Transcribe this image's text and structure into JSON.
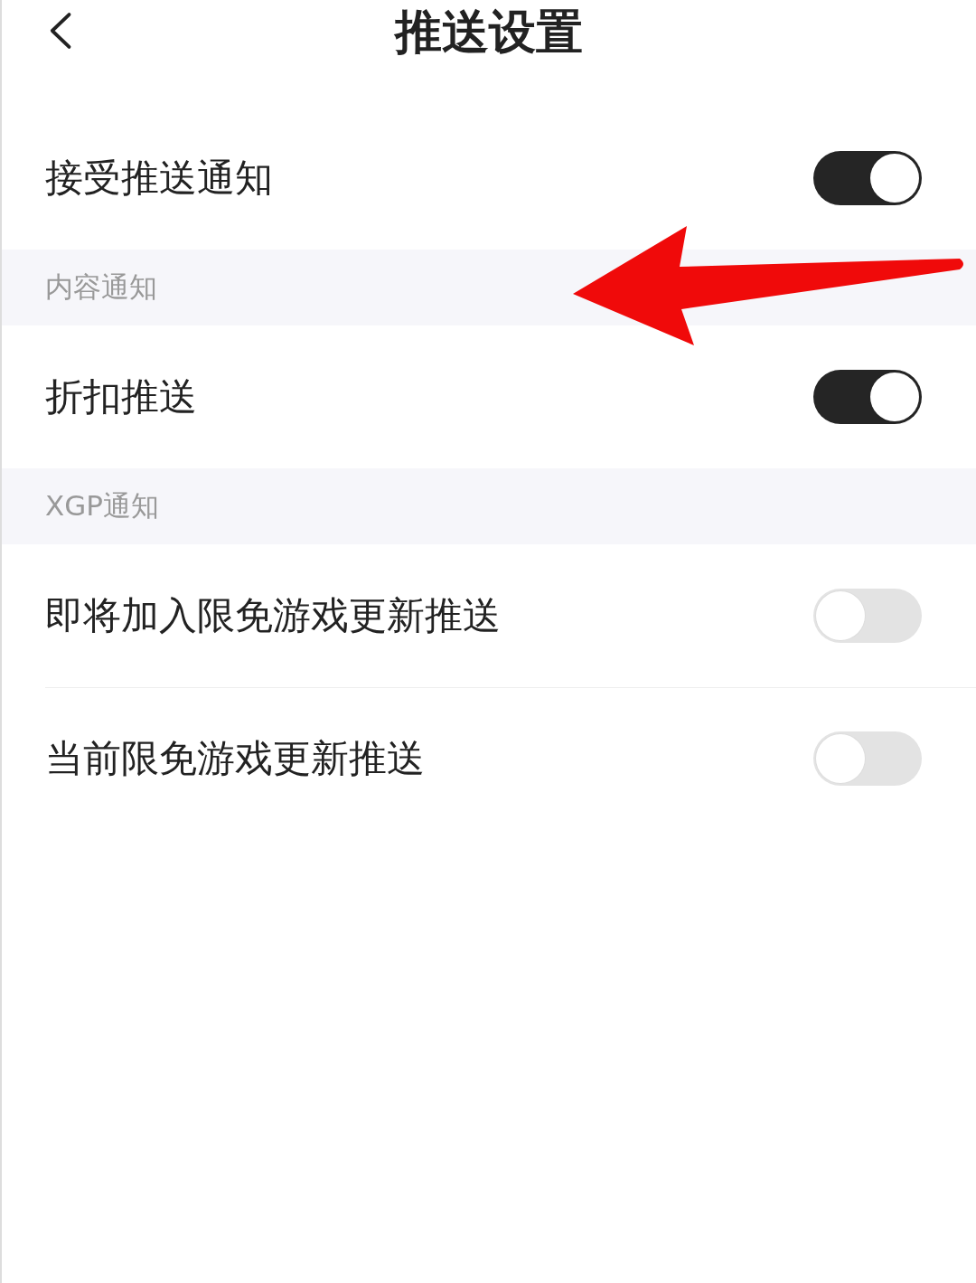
{
  "header": {
    "title": "推送设置"
  },
  "sections": [
    {
      "items": [
        {
          "label": "接受推送通知",
          "on": true
        }
      ]
    },
    {
      "heading": "内容通知",
      "items": [
        {
          "label": "折扣推送",
          "on": true
        }
      ]
    },
    {
      "heading": "XGP通知",
      "items": [
        {
          "label": "即将加入限免游戏更新推送",
          "on": false
        },
        {
          "label": "当前限免游戏更新推送",
          "on": false
        }
      ]
    }
  ]
}
